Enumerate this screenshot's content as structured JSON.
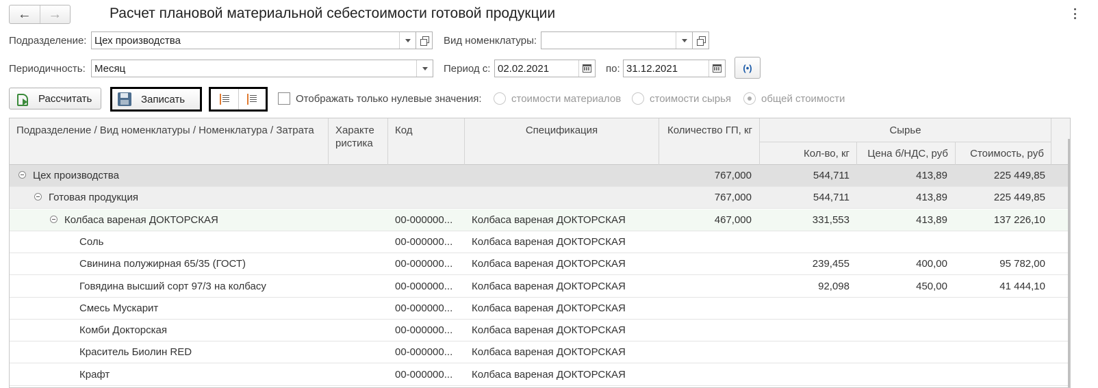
{
  "window": {
    "title": "Расчет плановой материальной себестоимости готовой продукции",
    "back_icon": "←",
    "forward_icon": "→"
  },
  "filters": {
    "division_label": "Подразделение:",
    "division_value": "Цех производства",
    "nomenclature_type_label": "Вид номенклатуры:",
    "nomenclature_type_value": "",
    "periodicity_label": "Периодичность:",
    "periodicity_value": "Месяц",
    "period_from_label": "Период с:",
    "period_from_value": "02.02.2021",
    "period_to_label": "по:",
    "period_to_value": "31.12.2021",
    "period_button_icon": "(•)"
  },
  "toolbar": {
    "calculate_label": "Рассчитать",
    "save_label": "Записать",
    "show_zero_label": "Отображать только нулевые значения:",
    "radio_materials": "стоимости материалов",
    "radio_raw": "стоимости сырья",
    "radio_total": "общей стоимости"
  },
  "table": {
    "headers": {
      "name": "Подразделение / Вид номенклатуры / Номенклатура / Затрата",
      "characteristic": "Характе ристика",
      "code": "Код",
      "specification": "Спецификация",
      "qty_gp": "Количество ГП, кг",
      "raw_group": "Сырье",
      "raw_qty": "Кол-во, кг",
      "raw_price": "Цена б/НДС, руб",
      "raw_cost": "Стоимость, руб"
    },
    "rows": [
      {
        "level": 0,
        "name": "Цех производства",
        "code": "",
        "spec": "",
        "qty_gp": "767,000",
        "qty": "544,711",
        "price": "413,89",
        "cost": "225 449,85"
      },
      {
        "level": 1,
        "name": "Готовая продукция",
        "code": "",
        "spec": "",
        "qty_gp": "767,000",
        "qty": "544,711",
        "price": "413,89",
        "cost": "225 449,85"
      },
      {
        "level": 2,
        "name": "Колбаса вареная ДОКТОРСКАЯ",
        "code": "00-000000...",
        "spec": "Колбаса вареная ДОКТОРСКАЯ",
        "qty_gp": "467,000",
        "qty": "331,553",
        "price": "413,89",
        "cost": "137 226,10"
      },
      {
        "level": 3,
        "name": "Соль",
        "code": "00-000000...",
        "spec": "Колбаса вареная ДОКТОРСКАЯ",
        "qty_gp": "",
        "qty": "",
        "price": "",
        "cost": ""
      },
      {
        "level": 3,
        "name": "Свинина полужирная 65/35 (ГОСТ)",
        "code": "00-000000...",
        "spec": "Колбаса вареная ДОКТОРСКАЯ",
        "qty_gp": "",
        "qty": "239,455",
        "price": "400,00",
        "cost": "95 782,00"
      },
      {
        "level": 3,
        "name": "Говядина высший сорт 97/3 на колбасу",
        "code": "00-000000...",
        "spec": "Колбаса вареная ДОКТОРСКАЯ",
        "qty_gp": "",
        "qty": "92,098",
        "price": "450,00",
        "cost": "41 444,10"
      },
      {
        "level": 3,
        "name": "Смесь Мускарит",
        "code": "00-000000...",
        "spec": "Колбаса вареная ДОКТОРСКАЯ",
        "qty_gp": "",
        "qty": "",
        "price": "",
        "cost": ""
      },
      {
        "level": 3,
        "name": "Комби Докторская",
        "code": "00-000000...",
        "spec": "Колбаса вареная ДОКТОРСКАЯ",
        "qty_gp": "",
        "qty": "",
        "price": "",
        "cost": ""
      },
      {
        "level": 3,
        "name": "Краситель Биолин RED",
        "code": "00-000000...",
        "spec": "Колбаса вареная ДОКТОРСКАЯ",
        "qty_gp": "",
        "qty": "",
        "price": "",
        "cost": ""
      },
      {
        "level": 3,
        "name": "Крафт",
        "code": "00-000000...",
        "spec": "Колбаса вареная ДОКТОРСКАЯ",
        "qty_gp": "",
        "qty": "",
        "price": "",
        "cost": ""
      }
    ]
  }
}
